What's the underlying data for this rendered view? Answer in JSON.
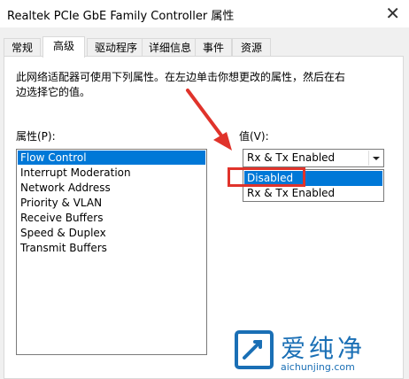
{
  "window": {
    "title": "Realtek PCIe GbE Family Controller 属性",
    "close_glyph": "✕"
  },
  "tabs": [
    {
      "label": "常规",
      "active": false
    },
    {
      "label": "高级",
      "active": true
    },
    {
      "label": "驱动程序",
      "active": false
    },
    {
      "label": "详细信息",
      "active": false
    },
    {
      "label": "事件",
      "active": false
    },
    {
      "label": "资源",
      "active": false
    }
  ],
  "advanced": {
    "description_line1": "此网络适配器可使用下列属性。在左边单击你想更改的属性，然后在右",
    "description_line2": "边选择它的值。",
    "property_label": "属性(P):",
    "value_label": "值(V):",
    "properties": [
      {
        "label": "Flow Control",
        "selected": true
      },
      {
        "label": "Interrupt Moderation",
        "selected": false
      },
      {
        "label": "Network Address",
        "selected": false
      },
      {
        "label": "Priority & VLAN",
        "selected": false
      },
      {
        "label": "Receive Buffers",
        "selected": false
      },
      {
        "label": "Speed & Duplex",
        "selected": false
      },
      {
        "label": "Transmit Buffers",
        "selected": false
      }
    ],
    "value_current": "Rx & Tx Enabled",
    "value_options": [
      {
        "label": "Disabled",
        "highlighted": true
      },
      {
        "label": "Rx & Tx Enabled",
        "highlighted": false
      }
    ]
  },
  "annotation": {
    "arrow_color": "#e0332b",
    "box_color": "#e0332b"
  },
  "watermark": {
    "brand": "爱纯净",
    "url": "aichunjing.com",
    "color": "#1a6fb5"
  }
}
